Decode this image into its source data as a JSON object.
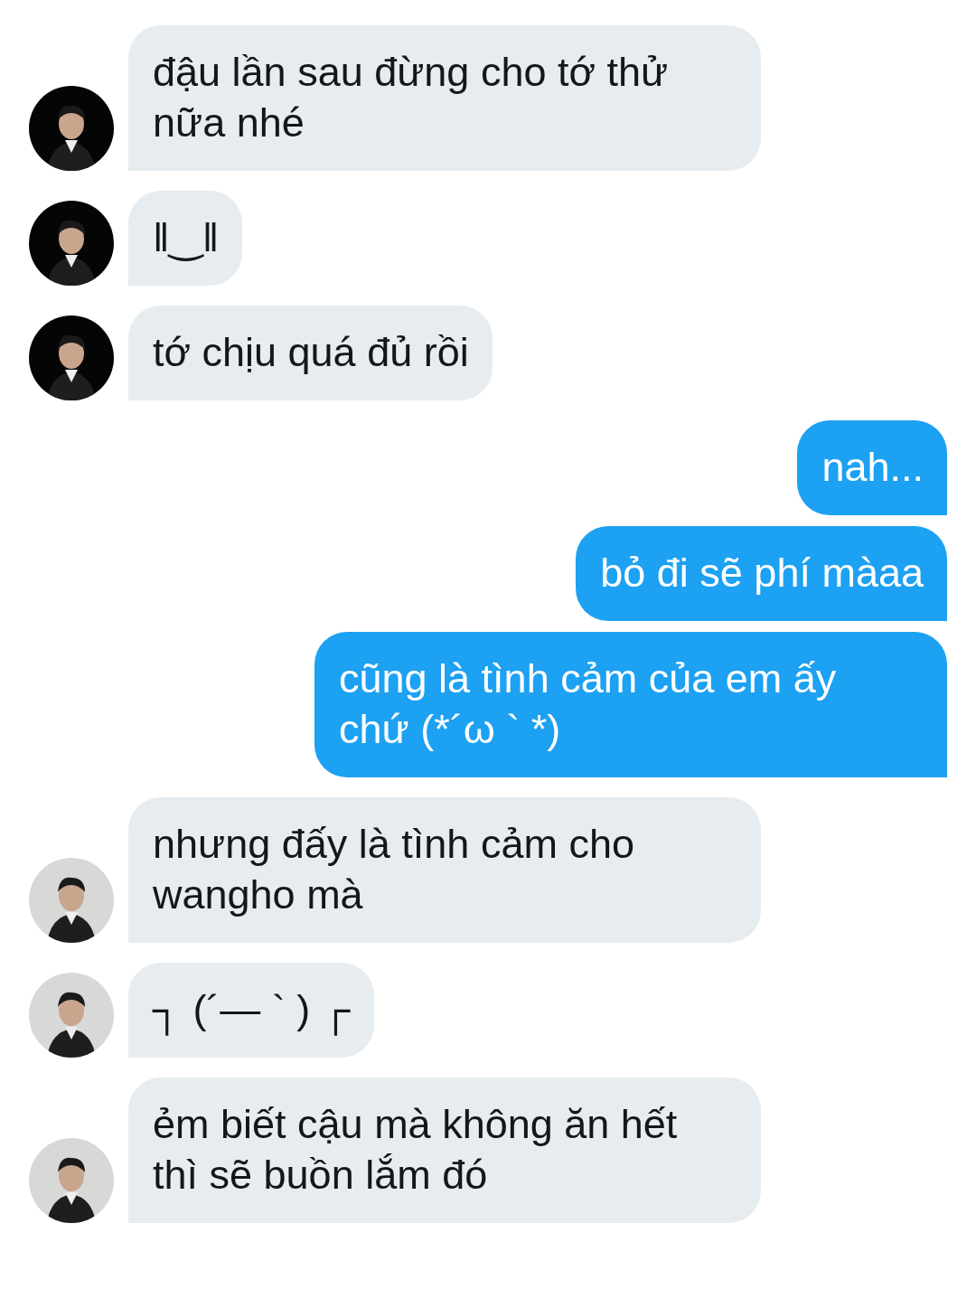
{
  "messages": [
    {
      "kind": "incoming",
      "avatar": {
        "kind": "picture",
        "color": "#050505"
      },
      "lines": [
        "đậu lần sau đừng cho tớ thử",
        "nữa nhé"
      ]
    },
    {
      "kind": "incoming",
      "avatar": {
        "kind": "picture",
        "color": "#050505"
      },
      "lines": [
        "ǁ‿ǁ"
      ]
    },
    {
      "kind": "incoming",
      "avatar": {
        "kind": "picture",
        "color": "#050505"
      },
      "lines": [
        "tớ chịu quá đủ rồi"
      ]
    },
    {
      "kind": "outgoing",
      "lines": [
        "nah..."
      ]
    },
    {
      "kind": "outgoing",
      "lines": [
        "bỏ đi sẽ phí màaa"
      ]
    },
    {
      "kind": "outgoing",
      "lines": [
        "cũng là tình cảm của em ấy",
        "chứ (*´ω ` *)"
      ]
    },
    {
      "kind": "incoming",
      "avatar": {
        "kind": "picture",
        "color": "#d8d8d6"
      },
      "lines": [
        "nhưng đấy là tình cảm cho",
        "wangho mà"
      ]
    },
    {
      "kind": "incoming",
      "avatar": {
        "kind": "picture",
        "color": "#d8d8d6"
      },
      "lines": [
        "┐ (´— ` ) ┌"
      ]
    },
    {
      "kind": "incoming",
      "avatar": {
        "kind": "picture",
        "color": "#d8d8d6"
      },
      "lines": [
        "ẻm biết cậu mà không ăn hết",
        "thì sẽ buồn lắm đó"
      ]
    }
  ]
}
